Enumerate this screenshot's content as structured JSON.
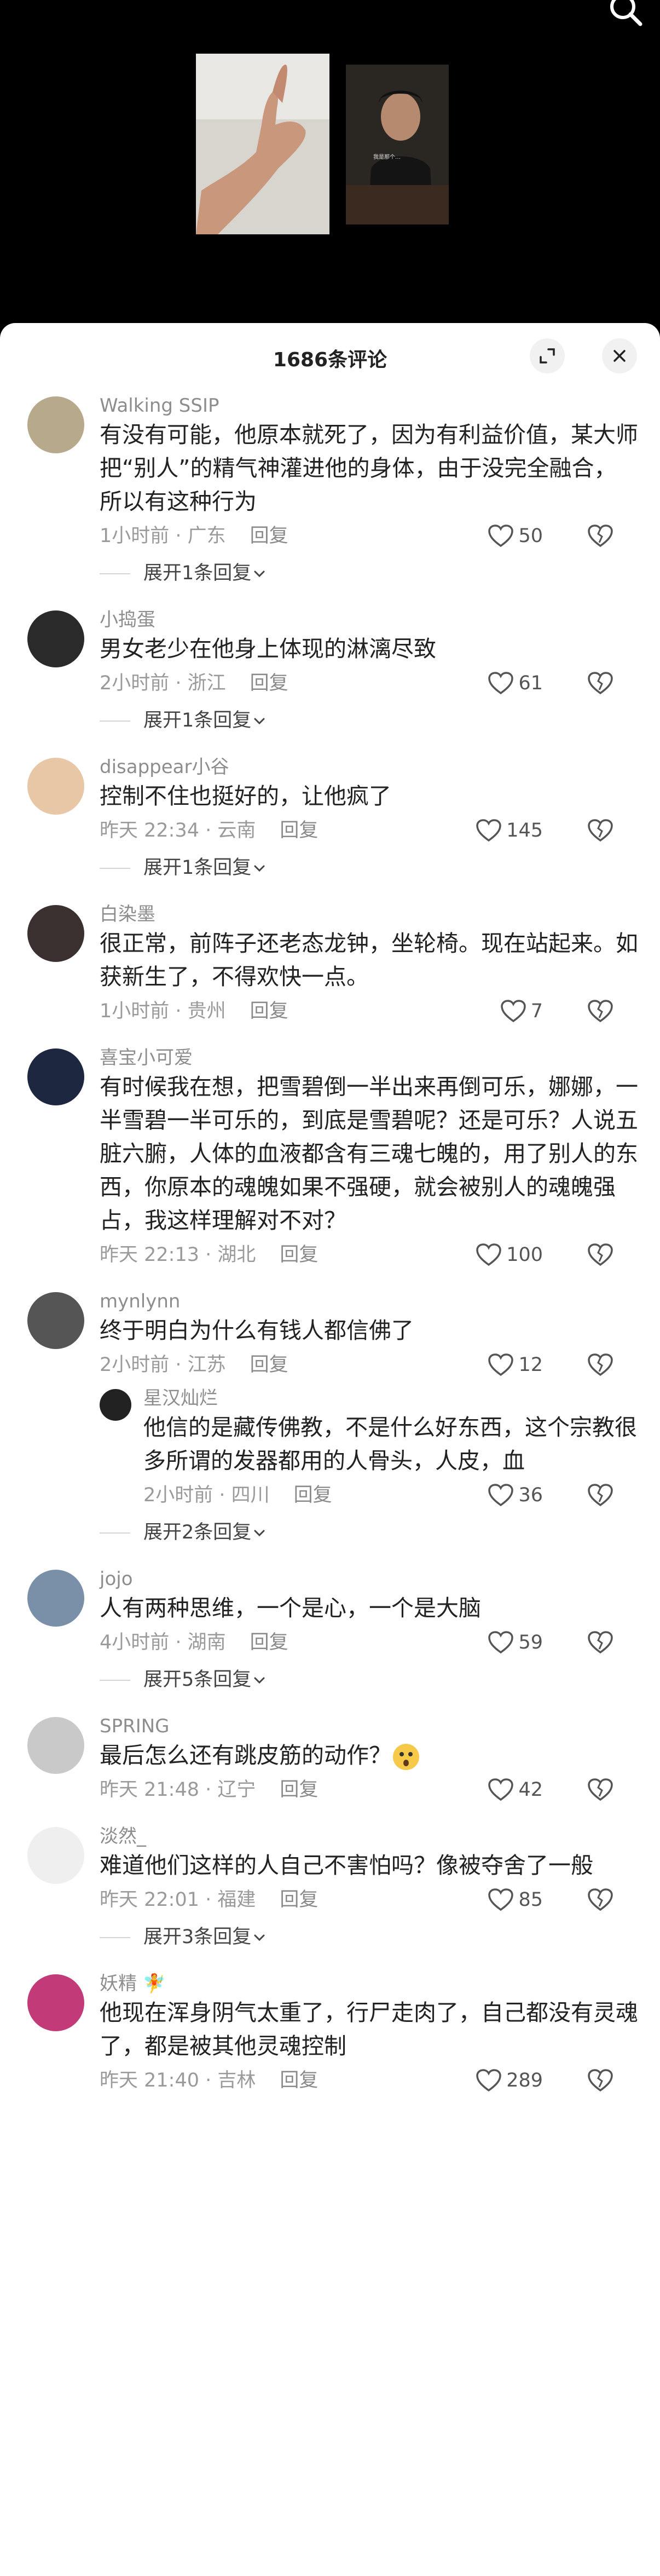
{
  "sheet": {
    "title": "1686条评论"
  },
  "thumb_caption": "我是那个…",
  "comments": [
    {
      "name": "Walking SSIP",
      "text": "有没有可能，他原本就死了，因为有利益价值，某大师把“别人”的精气神灌进他的身体，由于没完全融合，所以有这种行为",
      "time": "1小时前 · 广东",
      "reply": "回复",
      "likes": "50",
      "expand": "展开1条回复",
      "avatar": "#b7aa8c"
    },
    {
      "name": "小捣蛋",
      "text": "男女老少在他身上体现的淋漓尽致",
      "time": "2小时前 · 浙江",
      "reply": "回复",
      "likes": "61",
      "expand": "展开1条回复",
      "avatar": "#2a2a2a"
    },
    {
      "name": "disappear小谷",
      "text": "控制不住也挺好的，让他疯了",
      "time": "昨天 22:34 · 云南",
      "reply": "回复",
      "likes": "145",
      "expand": "展开1条回复",
      "avatar": "#e8c7a6"
    },
    {
      "name": "白染墨",
      "text": "很正常，前阵子还老态龙钟，坐轮椅。现在站起来。如获新生了，不得欢快一点。",
      "time": "1小时前 · 贵州",
      "reply": "回复",
      "likes": "7",
      "avatar": "#3a3030"
    },
    {
      "name": "喜宝小可爱",
      "text": "有时候我在想，把雪碧倒一半出来再倒可乐，娜娜，一半雪碧一半可乐的，到底是雪碧呢？还是可乐？人说五脏六腑，人体的血液都含有三魂七魄的，用了别人的东西，你原本的魂魄如果不强硬，就会被别人的魂魄强占，我这样理解对不对？",
      "time": "昨天 22:13 · 湖北",
      "reply": "回复",
      "likes": "100",
      "avatar": "#1d2740"
    },
    {
      "name": "mynlynn",
      "text": "终于明白为什么有钱人都信佛了",
      "time": "2小时前 · 江苏",
      "reply": "回复",
      "likes": "12",
      "avatar": "#555"
    },
    {
      "name": "星汉灿烂",
      "text": "他信的是藏传佛教，不是什么好东西，这个宗教很多所谓的发器都用的人骨头，人皮，血",
      "time": "2小时前 · 四川",
      "reply": "回复",
      "likes": "36",
      "expand": "展开2条回复",
      "avatar": "#222",
      "is_reply": true
    },
    {
      "name": "jojo",
      "text": "人有两种思维，一个是心，一个是大脑",
      "time": "4小时前 · 湖南",
      "reply": "回复",
      "likes": "59",
      "expand": "展开5条回复",
      "avatar": "#7a8fa8"
    },
    {
      "name": "SPRING",
      "text": "最后怎么还有跳皮筋的动作？",
      "time": "昨天 21:48 · 辽宁",
      "reply": "回复",
      "likes": "42",
      "avatar": "#c9c9c9",
      "emoji": "thinking-face-icon"
    },
    {
      "name": "淡然_",
      "text": "难道他们这样的人自己不害怕吗？像被夺舍了一般",
      "time": "昨天 22:01 · 福建",
      "reply": "回复",
      "likes": "85",
      "expand": "展开3条回复",
      "avatar": "#efefef"
    },
    {
      "name": "妖精 🧚",
      "text": "他现在浑身阴气太重了，行尸走肉了，自己都没有灵魂了，都是被其他灵魂控制",
      "time": "昨天 21:40 · 吉林",
      "reply": "回复",
      "likes": "289",
      "avatar": "#c23a78"
    }
  ],
  "icons": {
    "search": "search-icon",
    "fullscreen": "fullscreen-icon",
    "close": "close-icon",
    "like": "heart-icon",
    "dislike": "broken-heart-icon"
  }
}
